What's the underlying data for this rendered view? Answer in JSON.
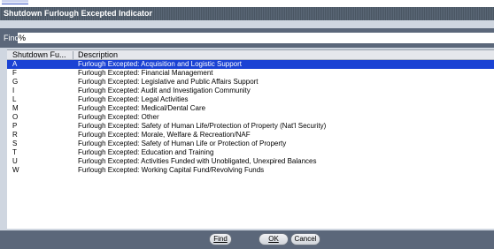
{
  "window": {
    "title": "Shutdown Furlough Excepted Indicator"
  },
  "find": {
    "label": "Find",
    "value": "%"
  },
  "list": {
    "columns": [
      "Shutdown Fu...",
      "Description"
    ],
    "selected_index": 0,
    "rows": [
      {
        "code": "A",
        "description": "Furlough Excepted:  Acquisition and Logistic Support"
      },
      {
        "code": "F",
        "description": "Furlough Excepted:  Financial Management"
      },
      {
        "code": "G",
        "description": "Furlough Excepted:  Legislative and Public Affairs Support"
      },
      {
        "code": "I",
        "description": "Furlough Excepted:  Audit and Investigation Community"
      },
      {
        "code": "L",
        "description": "Furlough Excepted:  Legal Activities"
      },
      {
        "code": "M",
        "description": "Furlough Excepted:  Medical/Dental Care"
      },
      {
        "code": "O",
        "description": "Furlough Excepted:  Other"
      },
      {
        "code": "P",
        "description": "Furlough Excepted:  Safety of Human Life/Protection of Property (Nat'l Security)"
      },
      {
        "code": "R",
        "description": "Furlough Excepted:  Morale, Welfare & Recreation/NAF"
      },
      {
        "code": "S",
        "description": "Furlough Excepted:  Safety of Human Life or Protection of Property"
      },
      {
        "code": "T",
        "description": "Furlough Excepted:  Education and Training"
      },
      {
        "code": "U",
        "description": "Furlough Excepted:  Activities Funded with Unobligated, Unexpired Balances"
      },
      {
        "code": "W",
        "description": "Furlough Excepted:  Working Capital Fund/Revolving Funds"
      }
    ]
  },
  "buttons": {
    "find": "Find",
    "ok": "OK",
    "cancel": "Cancel"
  },
  "colors": {
    "selection": "#1a42d4",
    "title_bar": "#4a5663",
    "panel": "#5b677a",
    "dialog_bg": "#cfd6e0"
  }
}
